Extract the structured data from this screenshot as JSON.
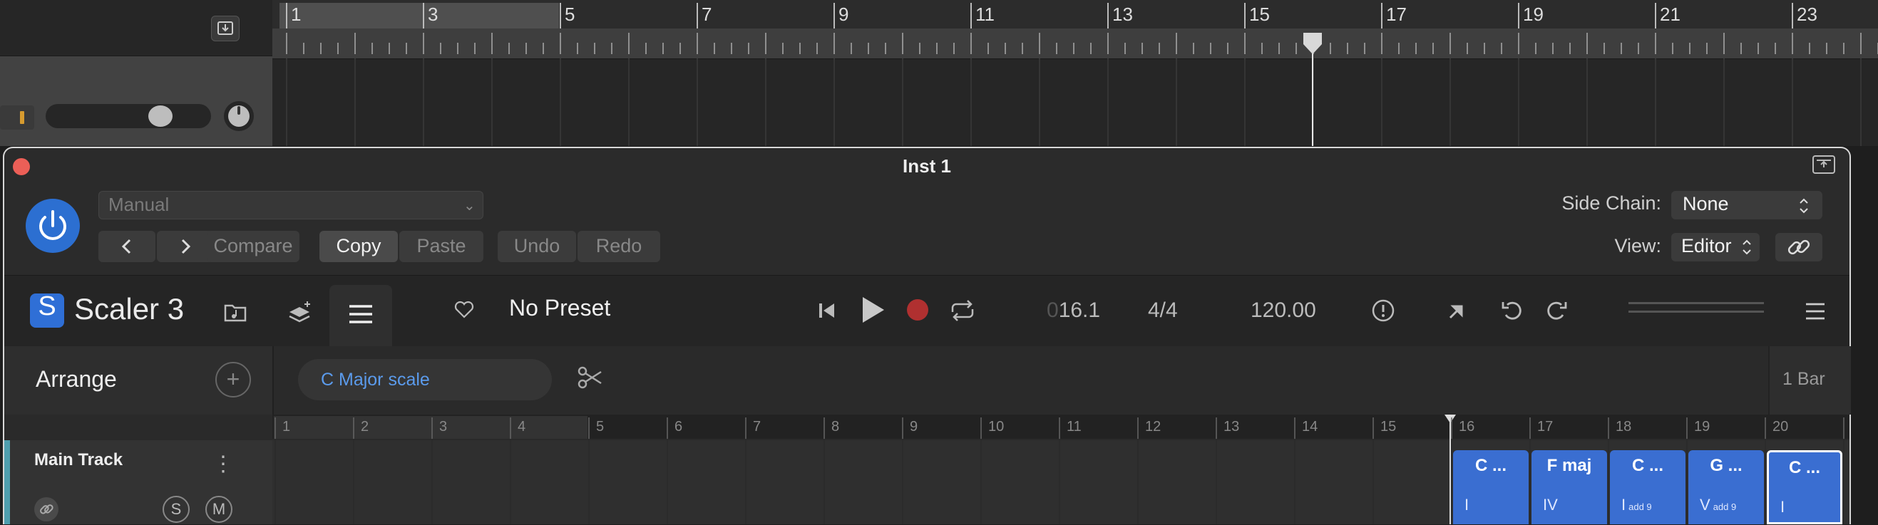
{
  "daw": {
    "ruler_numbers": [
      "1",
      "3",
      "5",
      "7",
      "9",
      "11",
      "13",
      "15",
      "17",
      "19",
      "21",
      "23"
    ],
    "playhead_bar": 16
  },
  "window": {
    "title": "Inst 1"
  },
  "plugin_header": {
    "preset_select": "Manual",
    "compare_label": "Compare",
    "copy_label": "Copy",
    "paste_label": "Paste",
    "undo_label": "Undo",
    "redo_label": "Redo",
    "side_chain_label": "Side Chain:",
    "side_chain_value": "None",
    "view_label": "View:",
    "view_value": "Editor"
  },
  "scaler": {
    "app_name": "Scaler 3",
    "logo_letter": "S",
    "preset_name": "No Preset",
    "position_dim": "0",
    "position": "16.1",
    "time_signature": "4/4",
    "tempo": "120.00"
  },
  "arrange": {
    "title": "Arrange",
    "add_symbol": "+",
    "scale_label": "C Major scale",
    "bar_length": "1 Bar",
    "ruler_numbers": [
      "1",
      "2",
      "3",
      "4",
      "5",
      "6",
      "7",
      "8",
      "9",
      "10",
      "11",
      "12",
      "13",
      "14",
      "15",
      "16",
      "17",
      "18",
      "19",
      "20"
    ],
    "track_name": "Main Track",
    "solo_label": "S",
    "mute_label": "M",
    "chords": [
      {
        "name": "C ...",
        "degree": "I",
        "ext": ""
      },
      {
        "name": "F maj",
        "degree": "IV",
        "ext": ""
      },
      {
        "name": "C ...",
        "degree": "I",
        "ext": "add 9"
      },
      {
        "name": "G ...",
        "degree": "V",
        "ext": "add 9"
      },
      {
        "name": "C ...",
        "degree": "I",
        "ext": ""
      }
    ]
  },
  "colors": {
    "accent_blue": "#2f6fd6",
    "chord_blue": "#3a6ed1",
    "record_red": "#b03030",
    "close_red": "#ec5f57",
    "track_teal": "#4e9eae"
  }
}
